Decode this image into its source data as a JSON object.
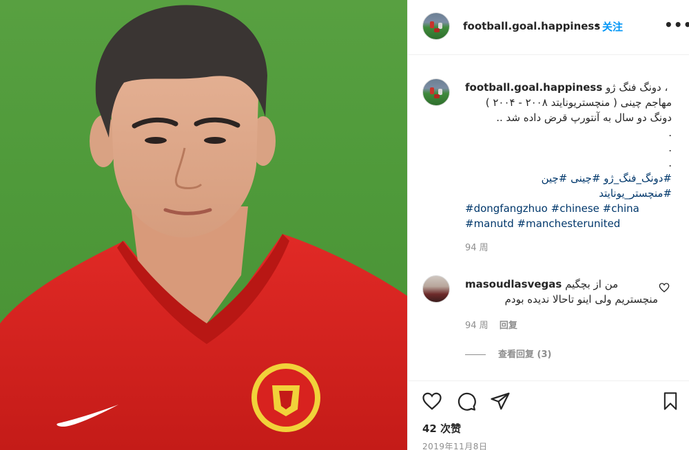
{
  "post": {
    "username": "football.goal.happiness",
    "separator": "•",
    "follow_label": "关注",
    "more_icon": "more-horizontal-icon",
    "more_label": "•••"
  },
  "caption": {
    "username": "football.goal.happiness",
    "line1_rtl": "دونگ فنگ ژو ،",
    "line2": "مهاجم چینی ( منچستریونایتد ۲۰۰۸ - ۲۰۰۴ )",
    "line3": "دونگ دو سال به آنتورپ قرض داده شد ..",
    "dots": [
      ".",
      ".",
      "."
    ],
    "hashtags_fa_1": "#دونگ_فنگ_ژو #چینی #چین",
    "hashtags_fa_2": "#منچستر_یونایتد",
    "hashtags_en_1": "#dongfangzhuo #chinese #china",
    "hashtags_en_2": "#manutd #manchesterunited",
    "time_ago": "94 周"
  },
  "comment": {
    "username": "masoudlasvegas",
    "text_part1": "من از بچگیم",
    "text_part2": "منچستریم ولی اینو تاحالا ندیده بودم",
    "time_ago": "94 周",
    "reply_label": "回复",
    "view_replies_label": "查看回复 (3)"
  },
  "actions": {
    "like_icon": "heart-icon",
    "comment_icon": "comment-icon",
    "share_icon": "share-icon",
    "save_icon": "bookmark-icon",
    "likes_text": "42 次赞",
    "date_text": "2019年11月8日"
  },
  "colors": {
    "link_blue": "#0095f6",
    "hashtag": "#00376b",
    "muted": "#8e8e8e",
    "text": "#262626",
    "shirt_red": "#d8221f",
    "pitch_green": "#4f9a3a"
  }
}
